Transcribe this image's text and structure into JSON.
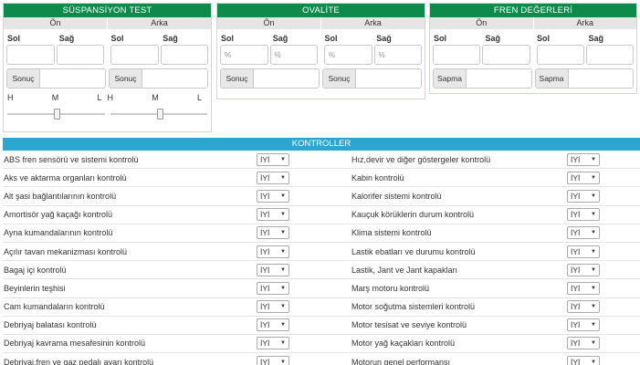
{
  "suspansiyon": {
    "title": "SÜSPANSİYON TEST",
    "front": "Ön",
    "rear": "Arka",
    "left": "Sol",
    "right": "Sağ",
    "result_label": "Sonuç",
    "scale": [
      "H",
      "M",
      "L"
    ]
  },
  "ovalite": {
    "title": "OVALİTE",
    "front": "Ön",
    "rear": "Arka",
    "left": "Sol",
    "right": "Sağ",
    "placeholder": "%",
    "result_label": "Sonuç"
  },
  "fren": {
    "title": "FREN DEĞERLERİ",
    "front": "Ön",
    "rear": "Arka",
    "left": "Sol",
    "right": "Sağ",
    "result_label": "Sapma"
  },
  "kontroller": {
    "title": "KONTROLLER",
    "default_value": "İYİ",
    "left": [
      "ABS fren sensörü ve sistemi kontrolü",
      "Aks ve aktarma organları kontrolü",
      "Alt şasi bağlantılarının kontrolü",
      "Amortisör yağ kaçağı kontrolü",
      "Ayna kumandalarının kontrolü",
      "Açılır tavan mekanizması kontrolü",
      "Bagaj içi kontrolü",
      "Beyinlerin teşhisi",
      "Cam kumandaların kontrolü",
      "Debriyaj balatası kontrolü",
      "Debriyaj kavrama mesafesinin kontrolü",
      "Debriyaj,fren ve gaz pedalı ayarı kontrolü"
    ],
    "right": [
      "Hız,devir ve diğer göstergeler kontrolü",
      "Kabin kontrolü",
      "Kalorifer sistemi kontrolü",
      "Kauçuk körüklerin durum kontrolü",
      "Klima sistemi kontrolü",
      "Lastik ebatları ve durumu kontrolü",
      "Lastik, Jant ve Jant kapakları",
      "Marş motoru kontrolü",
      "Motor soğutma sistemleri kontrolü",
      "Motor tesisat ve seviye kontrolü",
      "Motor yağ kaçakları kontrolü",
      "Motorun genel performansı"
    ]
  },
  "colors": {
    "green": "#0e8a4b",
    "blue": "#2aa6cf"
  },
  "icons": {
    "select_arrow": "triangle-down-icon"
  }
}
